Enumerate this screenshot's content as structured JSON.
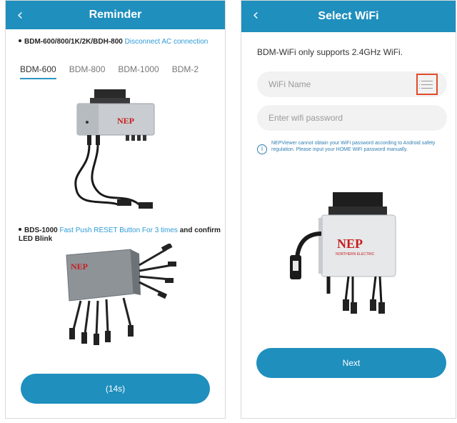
{
  "left": {
    "title": "Reminder",
    "back_icon": "chevron-left-icon",
    "bullet1": {
      "text": "BDM-600/800/1K/2K/BDH-800",
      "link": "Disconnect AC connection"
    },
    "tabs": [
      "BDM-600",
      "BDM-800",
      "BDM-1000",
      "BDM-2"
    ],
    "active_tab": 0,
    "bullet2": {
      "text": "BDS-1000",
      "link": "Fast Push RESET Button For 3 times",
      "suffix": "and confirm LED Blink"
    },
    "brand_logo": "NEP",
    "button_label": "(14s)"
  },
  "right": {
    "title": "Select WiFi",
    "back_icon": "chevron-left-icon",
    "info": "BDM-WiFi only supports 2.4GHz WiFi.",
    "wifi_name_placeholder": "WiFi Name",
    "wifi_password_placeholder": "Enter wifi password",
    "notice": "NEPViewer cannot obtain your WiFi password according to Android safety regulation. Please input your HOME WiFi password manually.",
    "brand_logo": "NEP",
    "brand_sub": "NORTHERN ELECTRIC",
    "next_label": "Next"
  },
  "colors": {
    "accent": "#1f8fbd",
    "link": "#2f9ad6",
    "highlight_box": "#e04b2b",
    "brand_red": "#c81e1e"
  }
}
